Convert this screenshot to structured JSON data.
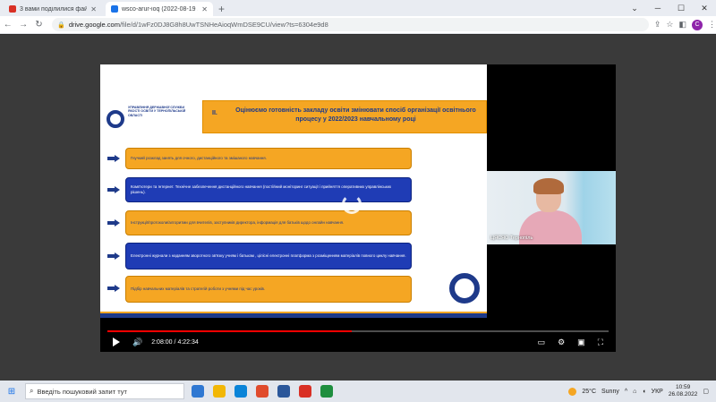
{
  "browser": {
    "tabs": [
      {
        "title": "3 вами поділилися файлом \"wsc",
        "favicon_color": "#d93025"
      },
      {
        "title": "wsco-arur-ioq (2022-08-19 11:01",
        "favicon_color": "#1a73e8"
      }
    ],
    "new_tab_label": "+",
    "url_host": "drive.google.com",
    "url_path": "/file/d/1wFz0DJ8G8h8UwTSNHeAioqWmDSE9CU/view?ts=6304e9d8",
    "avatar_letter": "C"
  },
  "slide": {
    "org_text": "УПРАВЛІННЯ ДЕРЖАВНОЇ СЛУЖБИ ЯКОСТІ ОСВІТИ У ТЕРНОПІЛЬСЬКІЙ ОБЛАСТІ",
    "section_number": "ІІ.",
    "heading": "Оцінюємо готовність закладу освіти змінювати спосіб організації освітнього процесу у 2022/2023 навчальному році",
    "items": [
      {
        "text": "Гнучкий розклад занять для очного, дистанційного та змішаного навчання.",
        "style": "orange"
      },
      {
        "text": "Комп'ютери та Інтернет. Технічне забезпечення дистанційного навчання (постійний моніторинг ситуації і прийняття оперативних управлінських рішень).",
        "style": "blue"
      },
      {
        "text": "Інструкції/протоколи/алгоритми для вчителів, заступників директора, інформація для батьків щодо онлайн навчання.",
        "style": "orange"
      },
      {
        "text": "Електронні журнали з наданням зворотного зв'язку учням і батькам , цілісні електронні платформа з розміщенням матеріалів повного циклу навчання.",
        "style": "blue"
      },
      {
        "text": "Підбір навчальних матеріалів та стратегій роботи з учнями під час уроків.",
        "style": "orange"
      }
    ]
  },
  "webcam": {
    "name_label": "ЦЯСЯО Тернопіль"
  },
  "player": {
    "current_time": "2:08:00",
    "separator": "/",
    "duration": "4:22:34",
    "progress_fraction": 0.487
  },
  "taskbar": {
    "search_placeholder": "Введіть пошуковий запит тут",
    "weather_temp": "25°C",
    "weather_text": "Sunny",
    "language": "УКР",
    "time": "10:59",
    "date": "26.08.2022",
    "apps": [
      "#2f78d2",
      "#f2b705",
      "#0a84d8",
      "#e04b2c",
      "#2b579a",
      "#d93025",
      "#1e8e3e"
    ]
  }
}
